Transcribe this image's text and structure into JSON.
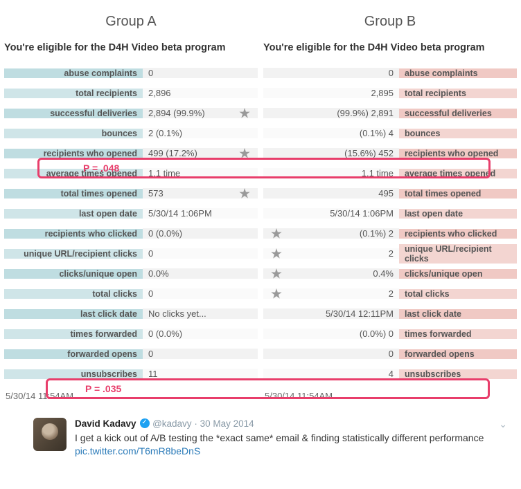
{
  "groups": {
    "a": {
      "title": "Group A",
      "subject": "You're eligible for the D4H Video beta program",
      "rows": [
        {
          "label": "abuse complaints",
          "value": "0",
          "star": false
        },
        {
          "label": "total recipients",
          "value": "2,896",
          "star": false
        },
        {
          "label": "successful deliveries",
          "value": "2,894 (99.9%)",
          "star": true
        },
        {
          "label": "bounces",
          "value": "2 (0.1%)",
          "star": false
        },
        {
          "label": "recipients who opened",
          "value": "499 (17.2%)",
          "star": true
        },
        {
          "label": "average times opened",
          "value": "1.1 time",
          "star": false
        },
        {
          "label": "total times opened",
          "value": "573",
          "star": true
        },
        {
          "label": "last open date",
          "value": "5/30/14 1:06PM",
          "star": false
        },
        {
          "label": "recipients who clicked",
          "value": "0 (0.0%)",
          "star": false
        },
        {
          "label": "unique URL/recipient clicks",
          "value": "0",
          "star": false
        },
        {
          "label": "clicks/unique open",
          "value": "0.0%",
          "star": false
        },
        {
          "label": "total clicks",
          "value": "0",
          "star": false
        },
        {
          "label": "last click date",
          "value": "No clicks yet...",
          "star": false
        },
        {
          "label": "times forwarded",
          "value": "0 (0.0%)",
          "star": false
        },
        {
          "label": "forwarded opens",
          "value": "0",
          "star": false
        },
        {
          "label": "unsubscribes",
          "value": "11",
          "star": false
        }
      ],
      "footer_time": "5/30/14 11:54AM"
    },
    "b": {
      "title": "Group B",
      "subject": "You're eligible for the D4H Video beta program",
      "rows": [
        {
          "label": "abuse complaints",
          "value": "0",
          "star": false
        },
        {
          "label": "total recipients",
          "value": "2,895",
          "star": false
        },
        {
          "label": "successful deliveries",
          "value": "(99.9%) 2,891",
          "star": false
        },
        {
          "label": "bounces",
          "value": "(0.1%) 4",
          "star": false
        },
        {
          "label": "recipients who opened",
          "value": "(15.6%) 452",
          "star": false
        },
        {
          "label": "average times opened",
          "value": "1.1 time",
          "star": false
        },
        {
          "label": "total times opened",
          "value": "495",
          "star": false
        },
        {
          "label": "last open date",
          "value": "5/30/14 1:06PM",
          "star": false
        },
        {
          "label": "recipients who clicked",
          "value": "(0.1%) 2",
          "star": true
        },
        {
          "label": "unique URL/recipient clicks",
          "value": "2",
          "star": true
        },
        {
          "label": "clicks/unique open",
          "value": "0.4%",
          "star": true
        },
        {
          "label": "total clicks",
          "value": "2",
          "star": true
        },
        {
          "label": "last click date",
          "value": "5/30/14 12:11PM",
          "star": false
        },
        {
          "label": "times forwarded",
          "value": "(0.0%) 0",
          "star": false
        },
        {
          "label": "forwarded opens",
          "value": "0",
          "star": false
        },
        {
          "label": "unsubscribes",
          "value": "4",
          "star": false
        }
      ],
      "footer_time": "5/30/14 11:54AM"
    }
  },
  "annotations": {
    "p1": "P = .048",
    "p2": "P = .035"
  },
  "tweet": {
    "name": "David Kadavy",
    "handle": "@kadavy",
    "date": "30 May 2014",
    "text": "I get a kick out of A/B testing the *exact same* email & finding statistically different performance",
    "link": "pic.twitter.com/T6mR8beDnS"
  }
}
